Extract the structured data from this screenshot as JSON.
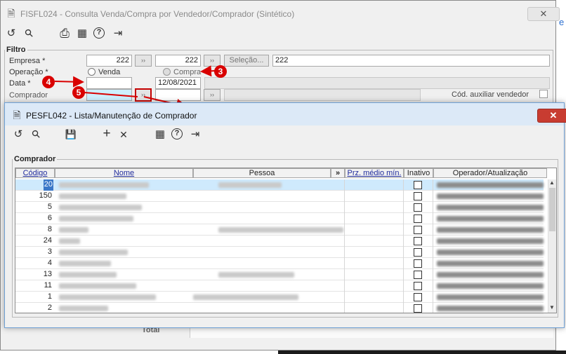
{
  "outer": {
    "title": "FISFL024 - Consulta Venda/Compra por Vendedor/Comprador (Sintético)",
    "close_glyph": "✕",
    "side_glyph": "e",
    "filtro_legend": "Filtro",
    "labels": {
      "empresa": "Empresa *",
      "operacao": "Operação *",
      "data": "Data *",
      "comprador": "Comprador",
      "cod_auxiliar": "Cód. auxiliar vendedor",
      "total": "Total"
    },
    "empresa_from": "222",
    "empresa_to": "222",
    "selecao_label": "Seleção...",
    "selecao_value": "222",
    "radio_venda": "Venda",
    "radio_compra": "Compra",
    "data_from": "",
    "data_to": "12/08/2021",
    "lookup_glyph": "››"
  },
  "annotations": [
    "3",
    "4",
    "5"
  ],
  "dialog": {
    "title": "PESFL042 - Lista/Manutenção de Comprador",
    "close_glyph": "✕",
    "group_legend": "Comprador",
    "columns": {
      "codigo": "Código",
      "nome": "Nome",
      "pessoa": "Pessoa",
      "more": "»",
      "prz": "Prz. médio mín.",
      "inativo": "Inativo",
      "operador": "Operador/Atualização"
    },
    "rows": [
      {
        "codigo": "20"
      },
      {
        "codigo": "150"
      },
      {
        "codigo": "5"
      },
      {
        "codigo": "6"
      },
      {
        "codigo": "8"
      },
      {
        "codigo": "24"
      },
      {
        "codigo": "3"
      },
      {
        "codigo": "4"
      },
      {
        "codigo": "13"
      },
      {
        "codigo": "11"
      },
      {
        "codigo": "1"
      },
      {
        "codigo": "2"
      }
    ]
  },
  "icons": {
    "refresh": "↺",
    "search": "⚲",
    "print": "⎙",
    "calendar": "▦",
    "help": "?",
    "exit": "⇥",
    "save": "💾",
    "add": "+",
    "delete": "✕",
    "doc": "🗎",
    "scroll_up": "▲",
    "scroll_down": "▼"
  },
  "colors": {
    "annotation_red": "#d90000",
    "selected_row": "#cfeafd",
    "dialog_title": "#dce9f7"
  }
}
